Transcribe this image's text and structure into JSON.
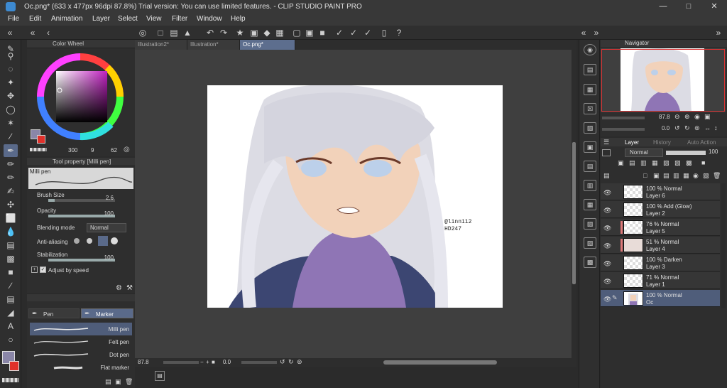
{
  "window": {
    "title": "Oc.png* (633 x 477px 96dpi 87.8%)  Trial version: You can use limited features. - CLIP STUDIO PAINT PRO"
  },
  "menu": [
    "File",
    "Edit",
    "Animation",
    "Layer",
    "Select",
    "View",
    "Filter",
    "Window",
    "Help"
  ],
  "tabs": [
    {
      "label": "Illustration2*",
      "active": false
    },
    {
      "label": "Illustration*",
      "active": false
    },
    {
      "label": "Oc.png*",
      "active": true
    }
  ],
  "color_wheel": {
    "title": "Color Wheel",
    "main_color": "#8a86a8",
    "sub_color": "#e0302a",
    "values": [
      "300",
      "9",
      "62"
    ]
  },
  "tool_property": {
    "title": "Tool property [Milli pen]",
    "preview_label": "Milli pen",
    "brush_size": {
      "label": "Brush Size",
      "value": "2.6"
    },
    "opacity": {
      "label": "Opacity",
      "value": "100"
    },
    "blending": {
      "label": "Blending mode",
      "value": "Normal"
    },
    "anti_aliasing": {
      "label": "Anti-aliasing"
    },
    "stabilization": {
      "label": "Stabilization",
      "value": "100"
    },
    "adjust_speed": {
      "label": "Adjust by speed",
      "checked": true
    }
  },
  "sub_tool": {
    "groups": [
      "Pen",
      "Marker"
    ],
    "brushes": [
      "Milli pen",
      "Felt pen",
      "Dot pen",
      "Flat marker"
    ]
  },
  "canvas": {
    "signature_line1": "@linn112",
    "signature_line2": "HD247"
  },
  "status": {
    "zoom": "87.8",
    "rotation": "0.0"
  },
  "navigator": {
    "title": "Navigator",
    "zoom": "87.8",
    "rotation": "0.0"
  },
  "layer_panel": {
    "tabs": [
      "Layer",
      "History",
      "Auto Action"
    ],
    "blend_mode": "Normal",
    "opacity": "100",
    "layers": [
      {
        "mode": "100 % Normal",
        "name": "Layer 6",
        "tag": false,
        "selected": false
      },
      {
        "mode": "100 % Add (Glow)",
        "name": "Layer 2",
        "tag": false,
        "selected": false
      },
      {
        "mode": "76 % Normal",
        "name": "Layer 5",
        "tag": true,
        "selected": false
      },
      {
        "mode": "51 % Normal",
        "name": "Layer 4",
        "tag": true,
        "selected": false
      },
      {
        "mode": "100 % Darken",
        "name": "Layer 3",
        "tag": false,
        "selected": false
      },
      {
        "mode": "71 % Normal",
        "name": "Layer 1",
        "tag": false,
        "selected": false
      },
      {
        "mode": "100 % Normal",
        "name": "Oc",
        "tag": false,
        "selected": true
      }
    ]
  }
}
